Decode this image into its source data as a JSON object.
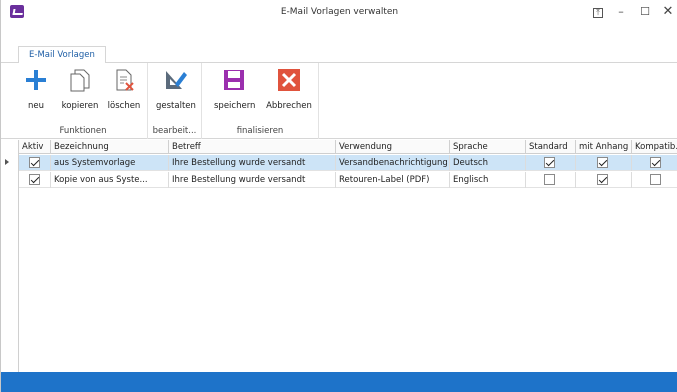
{
  "window": {
    "title": "E-Mail Vorlagen verwalten",
    "controls": {
      "pin": "⤒",
      "minimize": "–",
      "maximize": "☐",
      "close": "✕"
    }
  },
  "ribbon": {
    "tab_label": "E-Mail Vorlagen",
    "groups": {
      "funktionen": {
        "label": "Funktionen"
      },
      "bearbeiten": {
        "label": "bearbeit..."
      },
      "finalisieren": {
        "label": "finalisieren"
      }
    },
    "buttons": {
      "neu": {
        "label": "neu",
        "icon": "plus-icon"
      },
      "kopieren": {
        "label": "kopieren",
        "icon": "copy-icon"
      },
      "loeschen": {
        "label": "löschen",
        "icon": "delete-document-icon"
      },
      "gestalten": {
        "label": "gestalten",
        "icon": "design-icon"
      },
      "speichern": {
        "label": "speichern",
        "icon": "save-icon"
      },
      "abbrechen": {
        "label": "Abbrechen",
        "icon": "cancel-icon"
      }
    }
  },
  "grid": {
    "columns": [
      "Aktiv",
      "Bezeichnung",
      "Betreff",
      "Verwendung",
      "Sprache",
      "Standard",
      "mit Anhang",
      "Kompatib..."
    ],
    "rows": [
      {
        "aktiv": true,
        "bezeichnung": "aus Systemvorlage",
        "betreff": "Ihre Bestellung wurde versandt",
        "verwendung": "Versandbenachrichtigung",
        "sprache": "Deutsch",
        "standard": true,
        "mit_anhang": true,
        "kompatibel": true,
        "selected": true
      },
      {
        "aktiv": true,
        "bezeichnung": "Kopie von aus Syste...",
        "betreff": "Ihre Bestellung wurde versandt",
        "verwendung": "Retouren-Label (PDF)",
        "sprache": "Englisch",
        "standard": false,
        "mit_anhang": true,
        "kompatibel": false,
        "selected": false
      }
    ]
  },
  "colors": {
    "accent": "#1e73c9",
    "selection": "#cde4f7",
    "brand": "#6a2f9c",
    "save": "#9b2fae",
    "cancel": "#e0533d",
    "add": "#2a7fd4"
  }
}
